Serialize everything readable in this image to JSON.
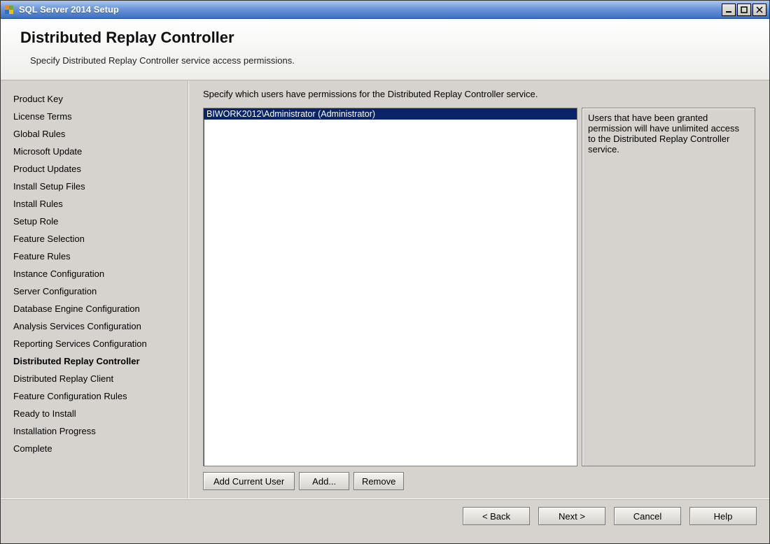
{
  "window": {
    "title": "SQL Server 2014 Setup"
  },
  "header": {
    "page_title": "Distributed Replay Controller",
    "page_subtitle": "Specify Distributed Replay Controller service access permissions."
  },
  "sidebar": {
    "items": [
      {
        "label": "Product Key",
        "current": false
      },
      {
        "label": "License Terms",
        "current": false
      },
      {
        "label": "Global Rules",
        "current": false
      },
      {
        "label": "Microsoft Update",
        "current": false
      },
      {
        "label": "Product Updates",
        "current": false
      },
      {
        "label": "Install Setup Files",
        "current": false
      },
      {
        "label": "Install Rules",
        "current": false
      },
      {
        "label": "Setup Role",
        "current": false
      },
      {
        "label": "Feature Selection",
        "current": false
      },
      {
        "label": "Feature Rules",
        "current": false
      },
      {
        "label": "Instance Configuration",
        "current": false
      },
      {
        "label": "Server Configuration",
        "current": false
      },
      {
        "label": "Database Engine Configuration",
        "current": false
      },
      {
        "label": "Analysis Services Configuration",
        "current": false
      },
      {
        "label": "Reporting Services Configuration",
        "current": false
      },
      {
        "label": "Distributed Replay Controller",
        "current": true
      },
      {
        "label": "Distributed Replay Client",
        "current": false
      },
      {
        "label": "Feature Configuration Rules",
        "current": false
      },
      {
        "label": "Ready to Install",
        "current": false
      },
      {
        "label": "Installation Progress",
        "current": false
      },
      {
        "label": "Complete",
        "current": false
      }
    ]
  },
  "main": {
    "caption": "Specify which users have permissions for the Distributed Replay Controller service.",
    "users": [
      "BIWORK2012\\Administrator (Administrator)"
    ],
    "info_text": "Users that have been granted permission will have unlimited access to the Distributed Replay Controller service.",
    "buttons": {
      "add_current": "Add Current User",
      "add": "Add...",
      "remove": "Remove"
    }
  },
  "footer": {
    "back": "< Back",
    "next": "Next >",
    "cancel": "Cancel",
    "help": "Help"
  }
}
